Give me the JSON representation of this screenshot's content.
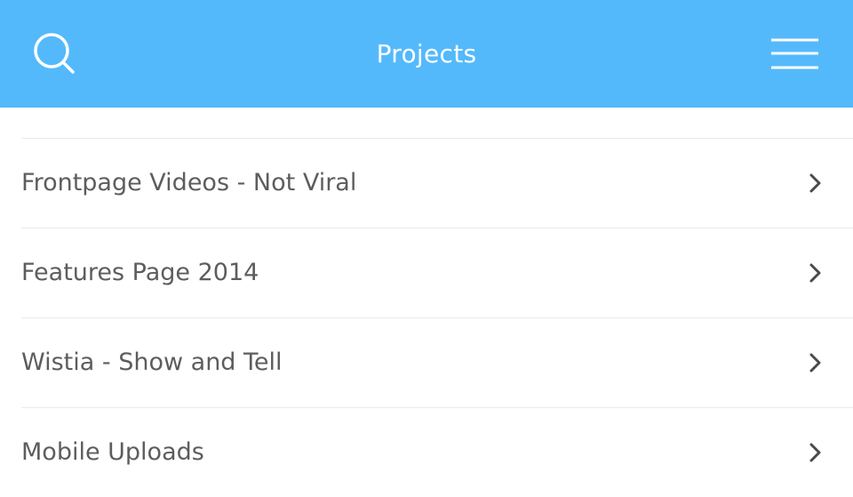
{
  "header": {
    "title": "Projects",
    "search_icon": "search-icon",
    "menu_icon": "hamburger-menu-icon",
    "background": "#54b9fb"
  },
  "projects": [
    {
      "label": "Frontpage Videos - Not Viral"
    },
    {
      "label": "Features Page 2014"
    },
    {
      "label": "Wistia - Show and Tell"
    },
    {
      "label": "Mobile Uploads"
    }
  ]
}
